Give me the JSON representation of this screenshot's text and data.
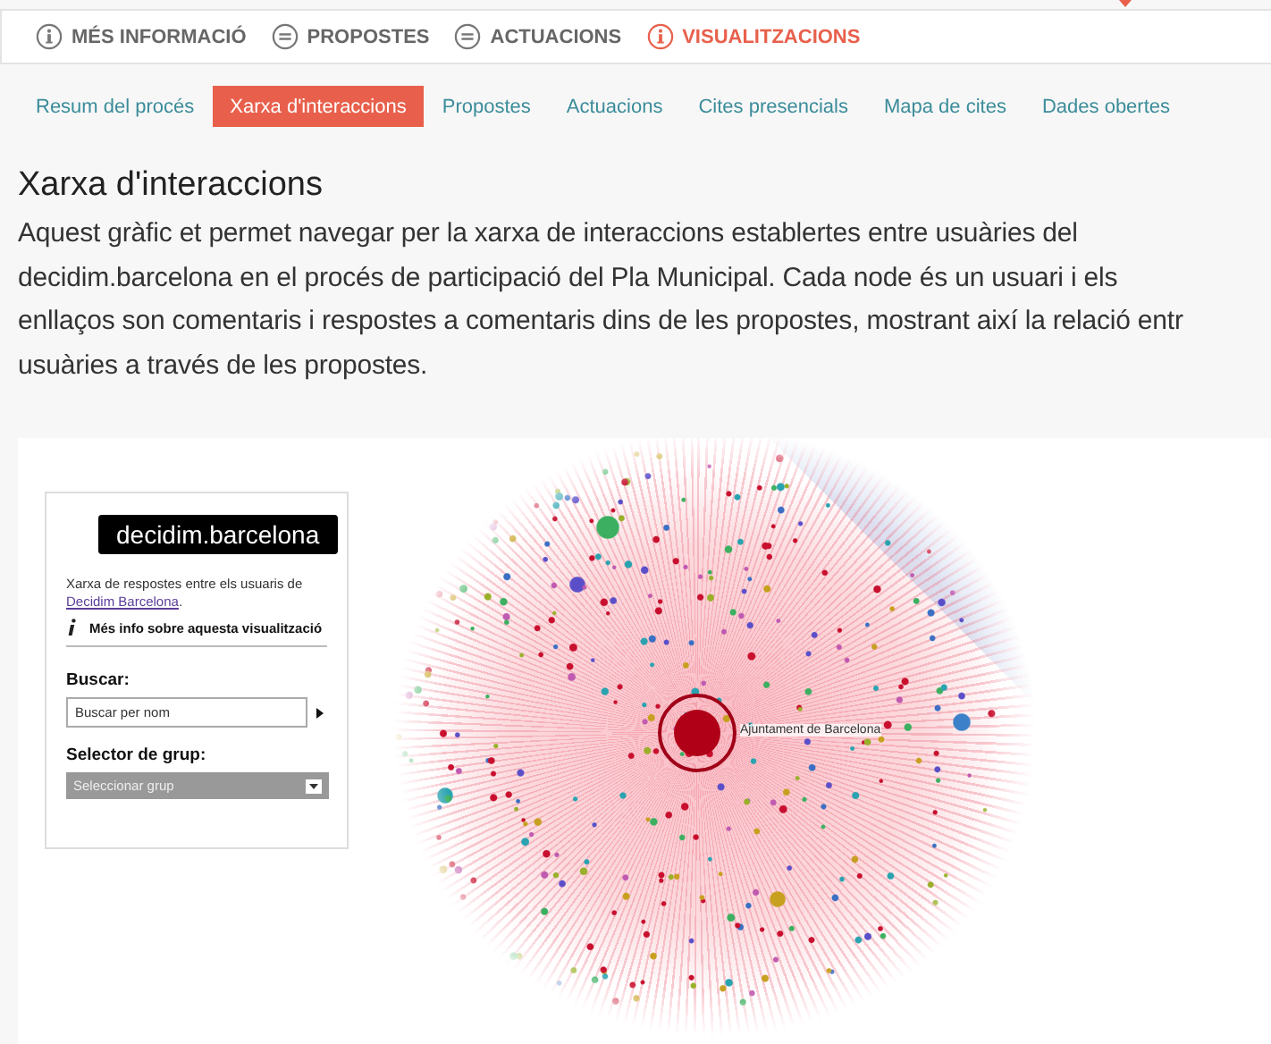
{
  "top_nav": [
    {
      "label": "MÉS INFORMACIÓ",
      "kind": "info",
      "selected": false
    },
    {
      "label": "PROPOSTES",
      "kind": "list",
      "selected": false
    },
    {
      "label": "ACTUACIONS",
      "kind": "list",
      "selected": false
    },
    {
      "label": "VISUALITZACIONS",
      "kind": "info",
      "selected": true
    }
  ],
  "sub_tabs": [
    {
      "label": "Resum del procés",
      "selected": false
    },
    {
      "label": "Xarxa d'interaccions",
      "selected": true
    },
    {
      "label": "Propostes",
      "selected": false
    },
    {
      "label": "Actuacions",
      "selected": false
    },
    {
      "label": "Cites presencials",
      "selected": false
    },
    {
      "label": "Mapa de cites",
      "selected": false
    },
    {
      "label": "Dades obertes",
      "selected": false
    }
  ],
  "heading": "Xarxa d'interaccions",
  "description_lines": [
    "Aquest gràfic et permet navegar per la xarxa de interaccions establertes entre usuàries del",
    "decidim.barcelona en el procés de participació del Pla Municipal. Cada node és un usuari i els",
    "enllaços son comentaris i respostes a comentaris dins de les propostes, mostrant així la relació entr",
    "usuàries a través de les propostes."
  ],
  "sidebar": {
    "logo": "decidim.barcelona",
    "description": "Xarxa de respostes entre els usuaris de ",
    "link": "Decidim Barcelona",
    "description_end": ".",
    "info_link": "Més info sobre aquesta visualització",
    "search_label": "Buscar:",
    "search_placeholder": "Buscar per nom",
    "group_label": "Selector de grup:",
    "group_select": "Seleccionar grup"
  },
  "graph": {
    "node_label": "Ajuntament de Barcelona"
  }
}
